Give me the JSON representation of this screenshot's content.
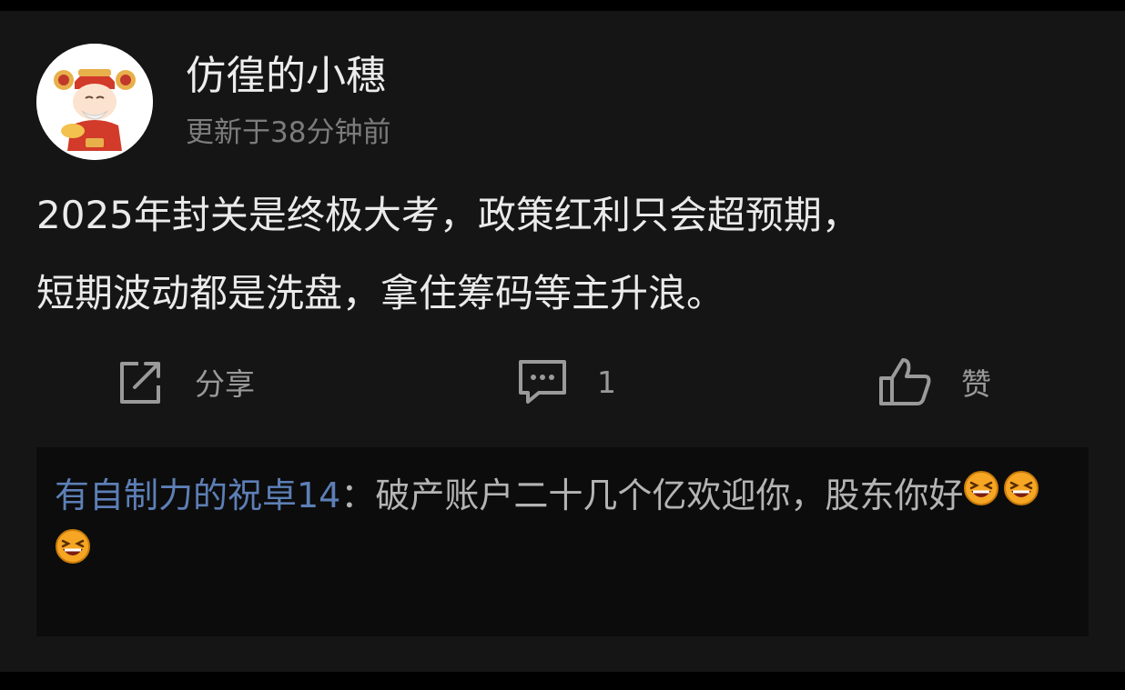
{
  "post": {
    "author": "仿徨的小穗",
    "updated": "更新于38分钟前",
    "text_line1": "2025年封关是终极大考，政策红利只会超预期，",
    "text_line2": "短期波动都是洗盘，拿住筹码等主升浪。"
  },
  "actions": {
    "share_label": "分享",
    "comment_count": "1",
    "like_label": "赞"
  },
  "comment": {
    "author": "有自制力的祝卓14",
    "separator": "：",
    "text": "破产账户二十几个亿欢迎你，股东你好",
    "emojis": [
      "laughing-emoji",
      "laughing-emoji",
      "laughing-emoji"
    ]
  },
  "colors": {
    "background": "#151515",
    "comment_author": "#5d7fb6",
    "emoji_face": "#f6a623"
  }
}
